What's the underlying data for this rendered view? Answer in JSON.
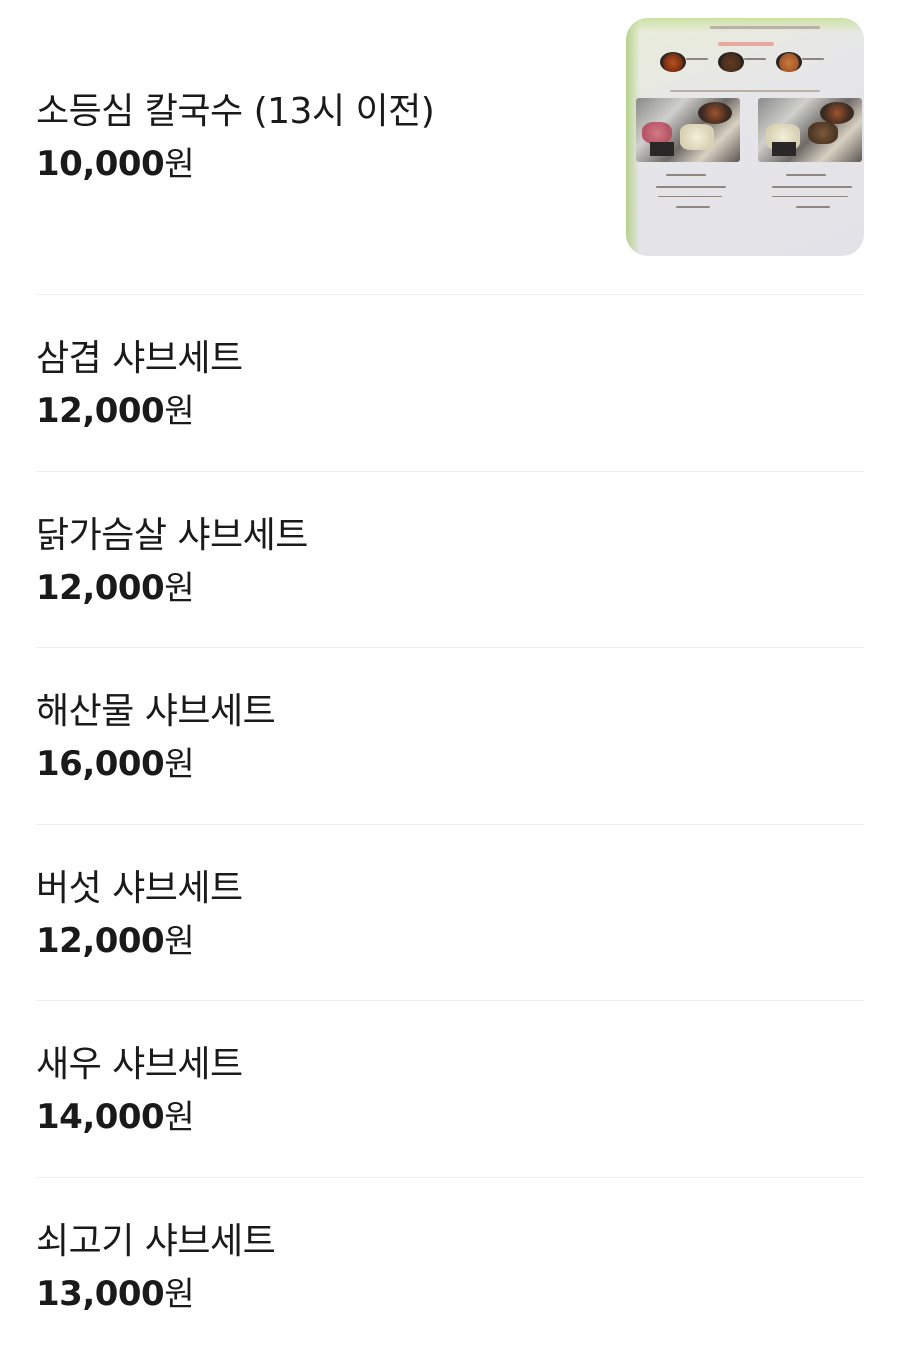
{
  "menu": {
    "items": [
      {
        "name": "소등심 칼국수 (13시 이전)",
        "price": "10,000",
        "currency": "원",
        "thumbnail": "menu-photo"
      },
      {
        "name": "삼겹 샤브세트",
        "price": "12,000",
        "currency": "원"
      },
      {
        "name": "닭가슴살 샤브세트",
        "price": "12,000",
        "currency": "원"
      },
      {
        "name": "해산물 샤브세트",
        "price": "16,000",
        "currency": "원"
      },
      {
        "name": "버섯 샤브세트",
        "price": "12,000",
        "currency": "원"
      },
      {
        "name": "새우 샤브세트",
        "price": "14,000",
        "currency": "원"
      },
      {
        "name": "쇠고기 샤브세트",
        "price": "13,000",
        "currency": "원"
      }
    ]
  },
  "colors": {
    "text": "#1a1a1a",
    "divider": "#efefef",
    "background": "#ffffff"
  }
}
